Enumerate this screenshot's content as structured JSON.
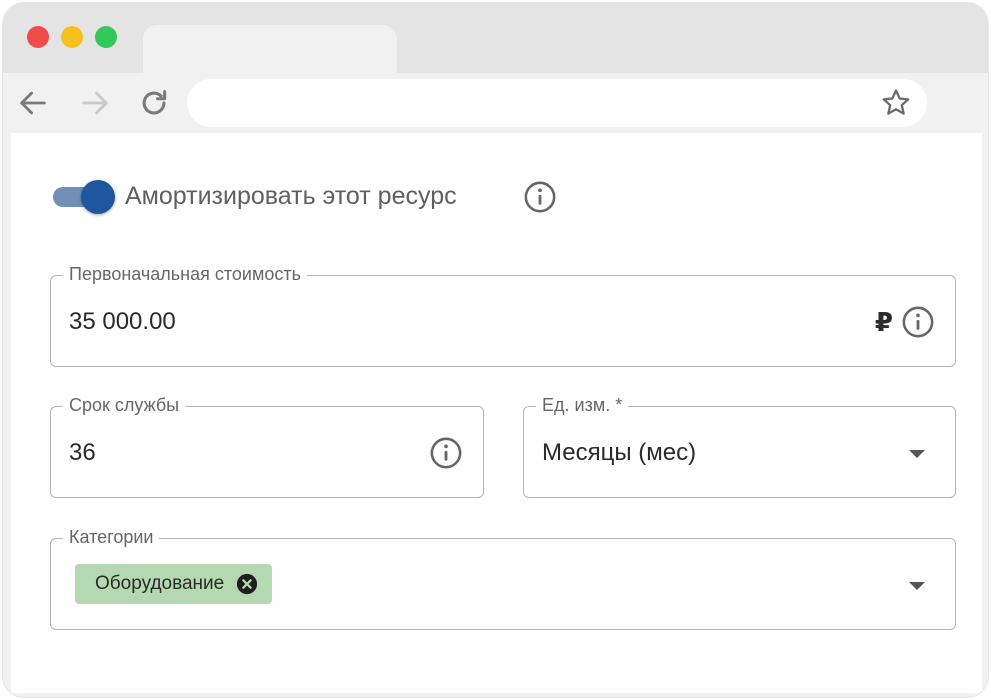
{
  "browser": {
    "icons": {
      "back": "arrow-left-icon",
      "forward": "arrow-right-icon",
      "reload": "reload-icon",
      "bookmark": "star-icon"
    },
    "address_value": ""
  },
  "form": {
    "amortize_toggle": {
      "label": "Амортизировать этот ресурс",
      "checked": true
    },
    "initial_cost": {
      "label": "Первоначальная стоимость",
      "value": "35 000.00",
      "currency_symbol": "₽"
    },
    "service_life": {
      "label": "Срок службы",
      "value": "36"
    },
    "unit": {
      "label": "Ед. изм. *",
      "selected": "Месяцы (мес)"
    },
    "categories": {
      "label": "Категории",
      "chips": [
        "Оборудование"
      ]
    }
  },
  "colors": {
    "toggle_thumb": "#1f56a0",
    "toggle_track": "#6f8fb6",
    "chip_bg": "#b4d8b0",
    "traffic_red": "#f04b4b",
    "traffic_yellow": "#f4c21b",
    "traffic_green": "#34c759"
  }
}
